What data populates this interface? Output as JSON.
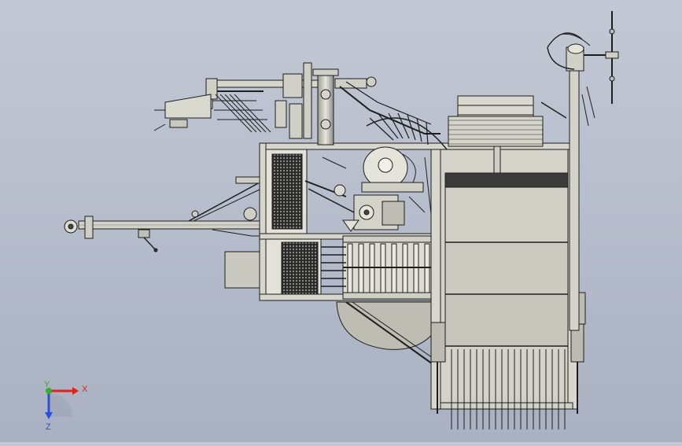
{
  "viewport": {
    "background_top": "#c3c8d4",
    "background_bottom": "#a9b1c2"
  },
  "triad": {
    "x_label": "X",
    "y_label": "Y",
    "z_label": "Z",
    "x_color": "#e02020",
    "y_color": "#2fb02f",
    "z_color": "#2a4fd8"
  },
  "model": {
    "line_color": "#1e1e1e",
    "body_fill": "#d9d9cf",
    "panel_fill": "#cfcfc6",
    "mesh_fill": "#2b2b2b"
  }
}
